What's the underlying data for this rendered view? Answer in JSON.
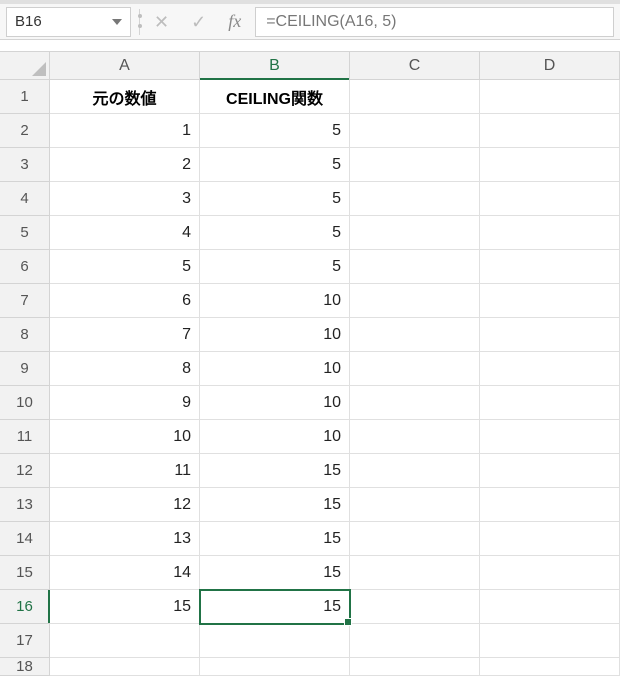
{
  "namebox": {
    "value": "B16"
  },
  "formula": {
    "text": "=CEILING(A16, 5)"
  },
  "icons": {
    "cancel": "✕",
    "confirm": "✓",
    "fx": "fx"
  },
  "columns": [
    "A",
    "B",
    "C",
    "D"
  ],
  "headers": {
    "A": "元の数値",
    "B": "CEILING関数"
  },
  "rows": [
    {
      "n": "1"
    },
    {
      "n": "2",
      "A": "1",
      "B": "5"
    },
    {
      "n": "3",
      "A": "2",
      "B": "5"
    },
    {
      "n": "4",
      "A": "3",
      "B": "5"
    },
    {
      "n": "5",
      "A": "4",
      "B": "5"
    },
    {
      "n": "6",
      "A": "5",
      "B": "5"
    },
    {
      "n": "7",
      "A": "6",
      "B": "10"
    },
    {
      "n": "8",
      "A": "7",
      "B": "10"
    },
    {
      "n": "9",
      "A": "8",
      "B": "10"
    },
    {
      "n": "10",
      "A": "9",
      "B": "10"
    },
    {
      "n": "11",
      "A": "10",
      "B": "10"
    },
    {
      "n": "12",
      "A": "11",
      "B": "15"
    },
    {
      "n": "13",
      "A": "12",
      "B": "15"
    },
    {
      "n": "14",
      "A": "13",
      "B": "15"
    },
    {
      "n": "15",
      "A": "14",
      "B": "15"
    },
    {
      "n": "16",
      "A": "15",
      "B": "15"
    },
    {
      "n": "17"
    },
    {
      "n": "18"
    }
  ],
  "active": {
    "row": "16",
    "col": "B"
  },
  "chart_data": {
    "type": "table",
    "title": "CEILING関数",
    "columns": [
      "元の数値",
      "CEILING関数"
    ],
    "data": [
      [
        1,
        5
      ],
      [
        2,
        5
      ],
      [
        3,
        5
      ],
      [
        4,
        5
      ],
      [
        5,
        5
      ],
      [
        6,
        10
      ],
      [
        7,
        10
      ],
      [
        8,
        10
      ],
      [
        9,
        10
      ],
      [
        10,
        10
      ],
      [
        11,
        15
      ],
      [
        12,
        15
      ],
      [
        13,
        15
      ],
      [
        14,
        15
      ],
      [
        15,
        15
      ]
    ]
  }
}
